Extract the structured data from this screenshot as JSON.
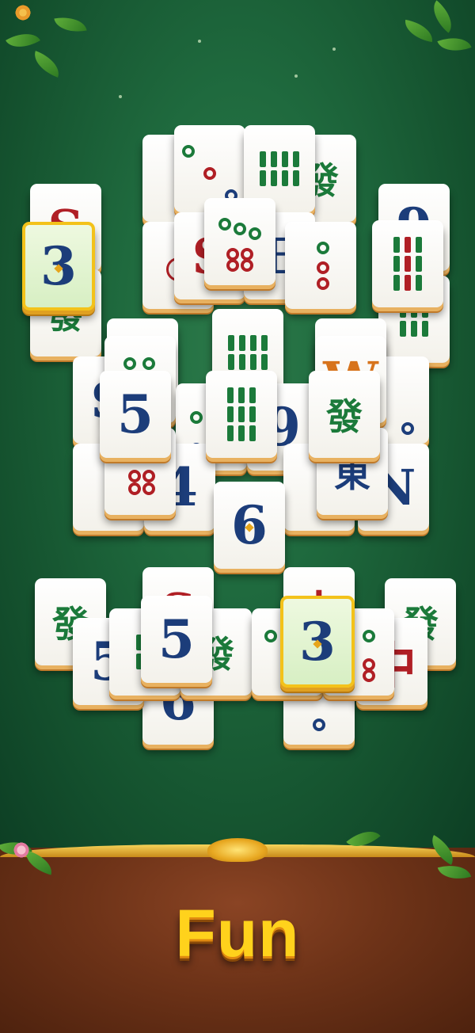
{
  "caption": "Fun",
  "tiles": {
    "three": "3",
    "five": "5",
    "six": "6",
    "nine": "9",
    "four": "4",
    "fa": "發",
    "zhong": "中",
    "dong": "東",
    "south_letter": "S",
    "east_letter": "E",
    "west_letter": "W",
    "north_letter": "N"
  },
  "colors": {
    "board": "#1f6a3e",
    "highlight_border": "#f3c21a",
    "caption": "#ffd21c",
    "panel": "#6e3318"
  }
}
